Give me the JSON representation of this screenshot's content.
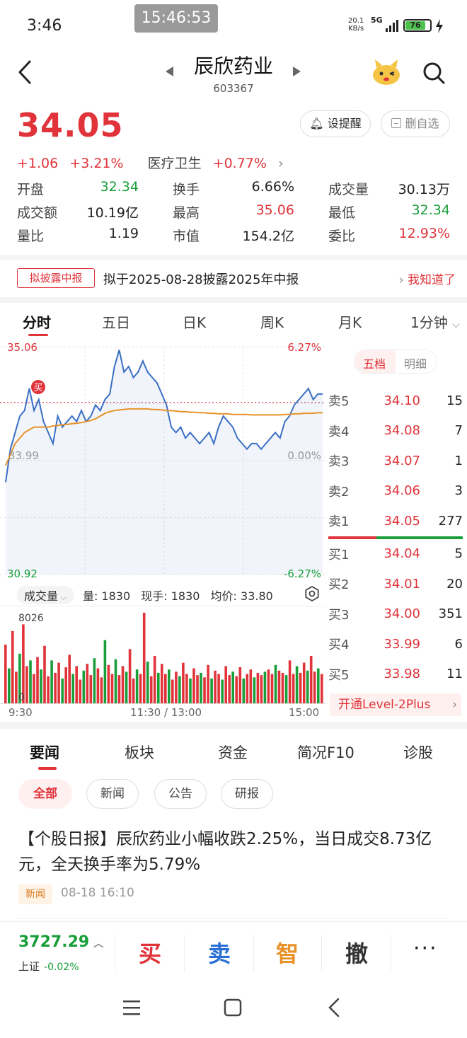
{
  "status_bar": {
    "time": "3:46",
    "overlay_time": "15:46:53",
    "net_speed_value": "20.1",
    "net_speed_unit": "KB/s",
    "network": "5G",
    "battery": "76"
  },
  "header": {
    "stock_name": "辰欣药业",
    "stock_code": "603367"
  },
  "quote": {
    "price": "34.05",
    "change": "+1.06",
    "change_pct": "+3.21%",
    "sector": "医疗卫生",
    "sector_change": "+0.77%",
    "alert_label": "设提醒",
    "remove_label": "删自选",
    "stats": [
      [
        {
          "label": "开盘",
          "value": "32.34",
          "color": "green"
        },
        {
          "label": "换手",
          "value": "6.66%",
          "color": "black"
        },
        {
          "label": "成交量",
          "value": "30.13万",
          "color": "black"
        }
      ],
      [
        {
          "label": "成交额",
          "value": "10.19亿",
          "color": "black"
        },
        {
          "label": "最高",
          "value": "35.06",
          "color": "red"
        },
        {
          "label": "最低",
          "value": "32.34",
          "color": "green"
        }
      ],
      [
        {
          "label": "量比",
          "value": "1.19",
          "color": "black"
        },
        {
          "label": "市值",
          "value": "154.2亿",
          "color": "black"
        },
        {
          "label": "委比",
          "value": "12.93%",
          "color": "red"
        }
      ]
    ]
  },
  "disclosure": {
    "tag": "拟披露中报",
    "text": "拟于2025-08-28披露2025年中报",
    "link": "我知道了"
  },
  "chart_tabs": [
    "分时",
    "五日",
    "日K",
    "周K",
    "月K",
    "1分钟"
  ],
  "chart_data": {
    "type": "line",
    "title": "",
    "price_high_label": "35.06",
    "price_low_label": "30.92",
    "price_mid_label": "33.99",
    "pct_high_label": "6.27%",
    "pct_low_label": "-6.27%",
    "pct_mid_label": "0.00%",
    "ylim": [
      30.92,
      35.06
    ],
    "prev_close": 32.99,
    "buy_marker": "买",
    "series": [
      {
        "values": [
          32.6,
          33.2,
          33.5,
          33.8,
          33.9,
          34.3,
          33.9,
          34.1,
          33.7,
          33.5,
          33.3,
          33.8,
          33.6,
          33.7,
          33.8,
          33.7,
          33.9,
          33.7,
          33.8,
          34.0,
          33.9,
          34.1,
          34.2,
          34.7,
          35.0,
          34.6,
          34.7,
          34.5,
          34.6,
          34.8,
          34.6,
          34.5,
          34.4,
          34.2,
          34.0,
          33.6,
          33.5,
          33.6,
          33.4,
          33.5,
          33.4,
          33.3,
          33.4,
          33.5,
          33.3,
          33.6,
          33.8,
          33.7,
          33.6,
          33.4,
          33.3,
          33.2,
          33.3,
          33.3,
          33.2,
          33.3,
          33.4,
          33.5,
          33.4,
          33.7,
          33.8,
          34.0,
          34.1,
          34.2,
          34.3,
          34.1,
          34.2,
          34.2
        ]
      },
      {
        "values": [
          32.9,
          33.1,
          33.3,
          33.4,
          33.5,
          33.55,
          33.6,
          33.6,
          33.6,
          33.6,
          33.62,
          33.63,
          33.64,
          33.65,
          33.66,
          33.67,
          33.68,
          33.7,
          33.72,
          33.75,
          33.8,
          33.85,
          33.88,
          33.9,
          33.91,
          33.92,
          33.93,
          33.93,
          33.93,
          33.93,
          33.93,
          33.92,
          33.92,
          33.91,
          33.9,
          33.9,
          33.89,
          33.88,
          33.88,
          33.87,
          33.87,
          33.86,
          33.86,
          33.85,
          33.85,
          33.84,
          33.84,
          33.84,
          33.83,
          33.83,
          33.83,
          33.83,
          33.82,
          33.82,
          33.82,
          33.82,
          33.82,
          33.82,
          33.82,
          33.83,
          33.83,
          33.84,
          33.84,
          33.85,
          33.85,
          33.85,
          33.86,
          33.86
        ]
      }
    ],
    "volume": {
      "max_label": "8026",
      "values": [
        5200,
        3100,
        6400,
        2800,
        4400,
        7000,
        3300,
        3800,
        2600,
        4100,
        3000,
        5100,
        2400,
        3800,
        2700,
        3600,
        2200,
        3200,
        4300,
        2600,
        3300,
        2100,
        2900,
        3500,
        2500,
        4000,
        3100,
        2300,
        5600,
        3400,
        2600,
        3900,
        2500,
        3300,
        2800,
        4800,
        2200,
        3000,
        2600,
        8026,
        3700,
        2400,
        4200,
        2700,
        3500,
        2600,
        3000,
        2100,
        2800,
        2400,
        3600,
        2600,
        2200,
        3100,
        2500,
        2700,
        2300,
        3400,
        2200,
        2900,
        2600,
        2100,
        3300,
        2500,
        2800,
        2400,
        3200,
        2200,
        2600,
        3000,
        2300,
        2700,
        2500,
        2800,
        3000,
        2600,
        3400,
        2900,
        2700,
        2500,
        3800,
        2600,
        3300,
        2700,
        3600,
        2900,
        4200,
        2800,
        3100,
        2600
      ]
    },
    "time_labels": [
      "9:30",
      "11:30 / 13:00",
      "15:00"
    ]
  },
  "volume_header": {
    "selector": "成交量",
    "volume": "量: 1830",
    "current": "现手: 1830",
    "avg": "均价: 33.80"
  },
  "order_book": {
    "tabs": [
      "五档",
      "明细"
    ],
    "asks": [
      {
        "side": "卖5",
        "price": "34.10",
        "volume": "15"
      },
      {
        "side": "卖4",
        "price": "34.08",
        "volume": "7"
      },
      {
        "side": "卖3",
        "price": "34.07",
        "volume": "1"
      },
      {
        "side": "卖2",
        "price": "34.06",
        "volume": "3"
      },
      {
        "side": "卖1",
        "price": "34.05",
        "volume": "277"
      }
    ],
    "bids": [
      {
        "side": "买1",
        "price": "34.04",
        "volume": "5"
      },
      {
        "side": "买2",
        "price": "34.01",
        "volume": "20"
      },
      {
        "side": "买3",
        "price": "34.00",
        "volume": "351"
      },
      {
        "side": "买4",
        "price": "33.99",
        "volume": "6"
      },
      {
        "side": "买5",
        "price": "33.98",
        "volume": "11"
      }
    ],
    "level2_label": "开通Level-2Plus"
  },
  "news": {
    "tabs": [
      "要闻",
      "板块",
      "资金",
      "简况F10",
      "诊股"
    ],
    "filters": [
      "全部",
      "新闻",
      "公告",
      "研报"
    ],
    "headline": "【个股日报】辰欣药业小幅收跌2.25%，当日成交8.73亿元，全天换手率为5.79%",
    "tag": "新闻",
    "time": "08-18 16:10"
  },
  "bottom_bar": {
    "index_value": "3727.29",
    "index_name": "上证",
    "index_change": "-0.02%",
    "buy": "买",
    "sell": "卖",
    "smart": "智",
    "cancel": "撤",
    "more": "···"
  },
  "colors": {
    "up": "#e0333a",
    "down": "#1a9e3a",
    "price_line": "#3a6fc4",
    "avg_line": "#e8922a"
  }
}
